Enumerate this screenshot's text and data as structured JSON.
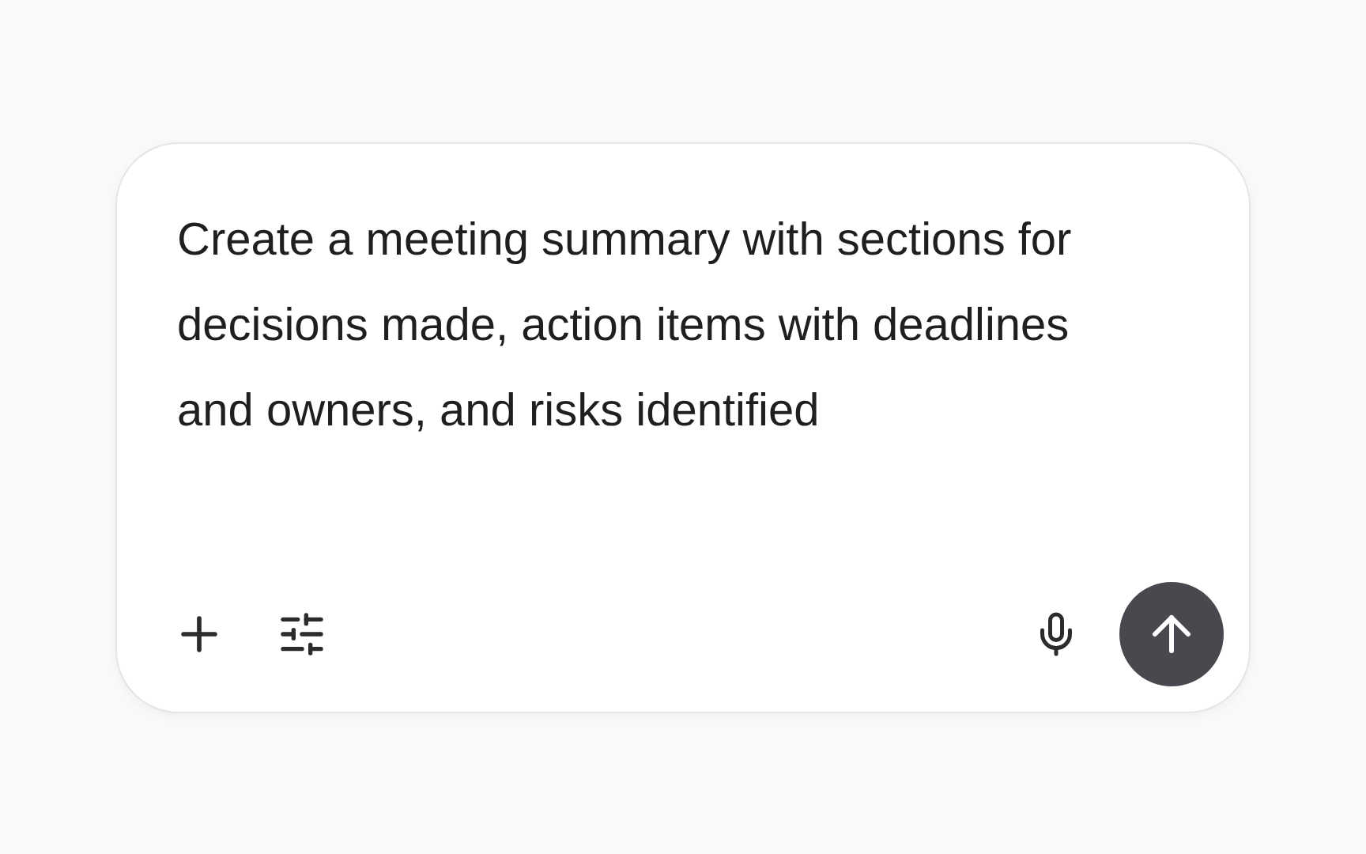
{
  "composer": {
    "value": "Create a meeting summary with sections for decisions made, action items with deadlines and owners, and risks identified"
  }
}
